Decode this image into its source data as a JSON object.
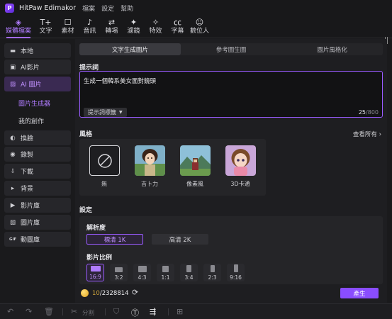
{
  "app": {
    "title": "HitPaw Edimakor",
    "logo_letter": "P"
  },
  "menubar": [
    "檔案",
    "設定",
    "幫助"
  ],
  "toolbar": [
    {
      "label": "媒體檔案",
      "icon": "media-icon",
      "glyph": "◈",
      "active": true
    },
    {
      "label": "文字",
      "icon": "text-icon",
      "glyph": "T+"
    },
    {
      "label": "素材",
      "icon": "sticker-icon",
      "glyph": "☐"
    },
    {
      "label": "音訊",
      "icon": "music-icon",
      "glyph": "♪"
    },
    {
      "label": "轉場",
      "icon": "transition-icon",
      "glyph": "⇄"
    },
    {
      "label": "濾鏡",
      "icon": "filter-icon",
      "glyph": "✦"
    },
    {
      "label": "特效",
      "icon": "effect-icon",
      "glyph": "✧"
    },
    {
      "label": "字幕",
      "icon": "subtitle-icon",
      "glyph": "㏄"
    },
    {
      "label": "數位人",
      "icon": "avatar-icon",
      "glyph": "☺"
    }
  ],
  "sidebar": {
    "items": [
      {
        "label": "本地",
        "icon": "folder-icon",
        "glyph": "▬"
      },
      {
        "label": "AI影片",
        "icon": "ai-video-icon",
        "glyph": "▣"
      },
      {
        "label": "AI 圖片",
        "icon": "ai-image-icon",
        "glyph": "▨",
        "active": true
      },
      {
        "label": "換臉",
        "icon": "face-swap-icon",
        "glyph": "◐"
      },
      {
        "label": "錄製",
        "icon": "record-icon",
        "glyph": "◉"
      },
      {
        "label": "下載",
        "icon": "download-icon",
        "glyph": "⇩"
      },
      {
        "label": "背景",
        "icon": "background-icon",
        "glyph": "▸"
      },
      {
        "label": "影片庫",
        "icon": "video-library-icon",
        "glyph": "▶"
      },
      {
        "label": "圖片庫",
        "icon": "image-library-icon",
        "glyph": "▧"
      },
      {
        "label": "動圖庫",
        "icon": "gif-library-icon",
        "glyph": "GIF"
      }
    ],
    "sub_items": [
      {
        "label": "圖片生成器",
        "active": true
      },
      {
        "label": "我的創作"
      }
    ]
  },
  "tabs": [
    "文字生成圖片",
    "參考圖生圖",
    "圖片風格化"
  ],
  "prompt": {
    "title": "提示詞",
    "value": "生成一個韓系美女面對鏡頭",
    "tag_button": "提示詞標籤",
    "count": "25",
    "max": "/800"
  },
  "styles": {
    "title": "風格",
    "see_all": "查看所有",
    "items": [
      {
        "label": "無",
        "icon": "none-icon"
      },
      {
        "label": "吉卜力",
        "icon": "ghibli-thumbnail"
      },
      {
        "label": "像素風",
        "icon": "pixel-thumbnail"
      },
      {
        "label": "3D卡通",
        "icon": "cartoon-3d-thumbnail"
      }
    ]
  },
  "settings": {
    "title": "設定",
    "resolution_title": "解析度",
    "resolutions": [
      {
        "label": "標清 1K",
        "active": true
      },
      {
        "label": "高清 2K"
      }
    ],
    "ratio_title": "影片比例",
    "ratios": [
      {
        "label": "16:9",
        "active": true
      },
      {
        "label": "3:2"
      },
      {
        "label": "4:3"
      },
      {
        "label": "1:1"
      },
      {
        "label": "3:4"
      },
      {
        "label": "2:3"
      },
      {
        "label": "9:16"
      }
    ]
  },
  "footer": {
    "credits_current": "10",
    "credits_total": "/2328814",
    "generate": "產生"
  },
  "bottombar": {
    "split": "分割"
  },
  "colors": {
    "accent": "#9a5bff",
    "panel": "#252528",
    "background": "#1a1a1c"
  }
}
